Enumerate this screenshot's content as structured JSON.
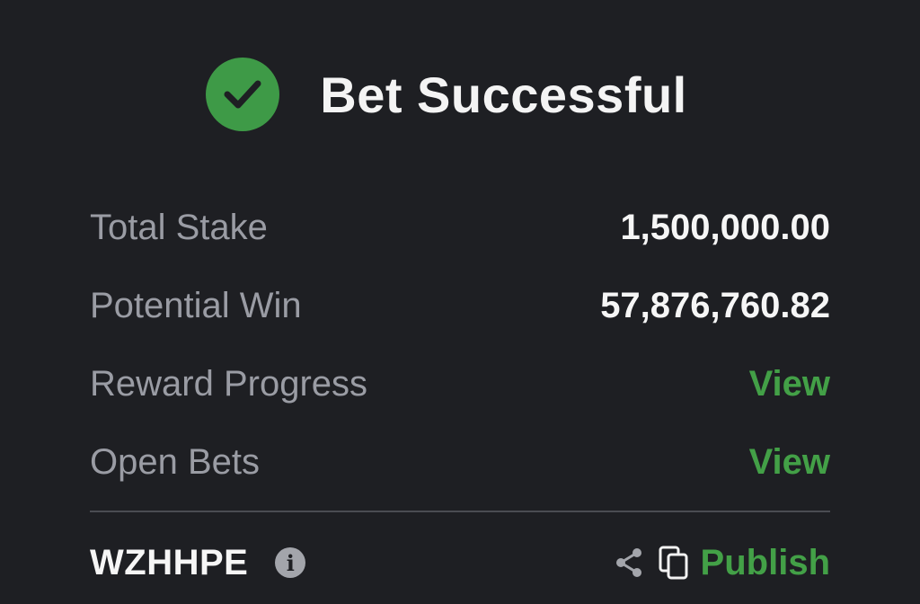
{
  "header": {
    "title": "Bet Successful",
    "icon": "check-circle-icon",
    "icon_color": "#3e9a47"
  },
  "rows": [
    {
      "label": "Total Stake",
      "value": "1,500,000.00"
    },
    {
      "label": "Potential Win",
      "value": "57,876,760.82"
    },
    {
      "label": "Reward Progress",
      "link": "View"
    },
    {
      "label": "Open Bets",
      "link": "View"
    }
  ],
  "footer": {
    "booking_code": "WZHHPE",
    "info_icon": "i",
    "share_icon": "share-icon",
    "copy_icon": "copy-icon",
    "publish_label": "Publish"
  },
  "colors": {
    "background": "#1e1f23",
    "accent_green": "#43a047",
    "label_gray": "#9a9ca4",
    "value_white": "#f6f6f6"
  }
}
